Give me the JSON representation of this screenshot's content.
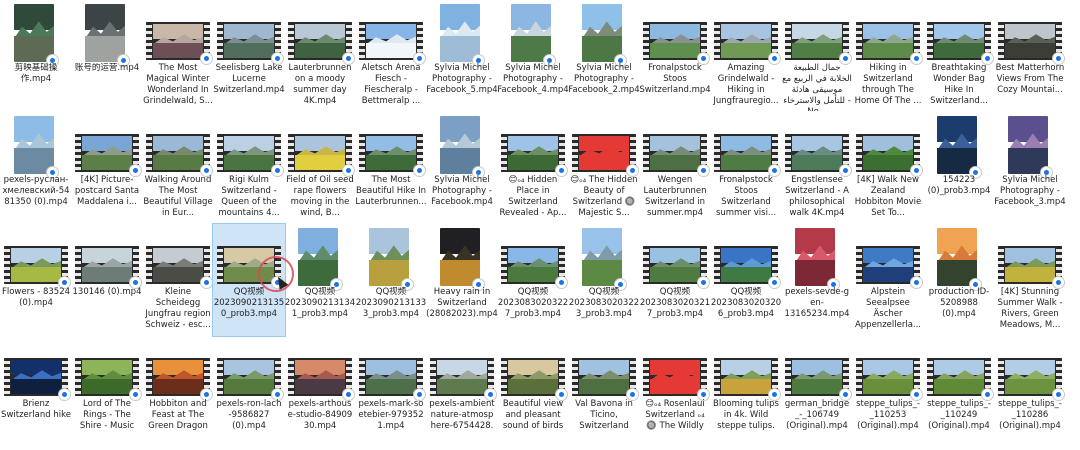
{
  "rows": [
    {
      "items": [
        {
          "label": "剪映基础操作.mp4",
          "kind": "port",
          "c1": "#2f4a3a",
          "c2": "#4c7a58",
          "c3": "#5d6b55"
        },
        {
          "label": "账号的运营.mp4",
          "kind": "port",
          "c1": "#3c4447",
          "c2": "#6b7170",
          "c3": "#9ea39f"
        },
        {
          "label": "The Most Magical Winter Wonderland In Grindelwald, S...",
          "kind": "vid",
          "c1": "#c9b8a8",
          "c2": "#b7a7a3",
          "c3": "#6d4f55"
        },
        {
          "label": "Seelisberg Lake Lucerne Switzerland.mp4",
          "kind": "vid",
          "c1": "#9fb7cf",
          "c2": "#7c8d93",
          "c3": "#4f6f5a"
        },
        {
          "label": "Lauterbrunnen on a moody summer day 4K.mp4",
          "kind": "vid",
          "c1": "#b8c8d4",
          "c2": "#6c8a6e",
          "c3": "#3f6340"
        },
        {
          "label": "Aletsch Arena Fiesch - Fiescheralp - Bettmeralp ...",
          "kind": "vid",
          "c1": "#87b5e8",
          "c2": "#dfe9f2",
          "c3": "#f3f6f8"
        },
        {
          "label": "Sylvia Michel Photography - Facebook_5.mp4",
          "kind": "port",
          "c1": "#7fb2e0",
          "c2": "#dce8f2",
          "c3": "#9fbcd6"
        },
        {
          "label": "Sylvia Michel Photography - Facebook_4.mp4",
          "kind": "port",
          "c1": "#8bb7e2",
          "c2": "#c8d5dd",
          "c3": "#4e7a4a"
        },
        {
          "label": "Sylvia Michel Photography - Facebook_2.mp4",
          "kind": "port",
          "c1": "#8ec0ea",
          "c2": "#7e8d7a",
          "c3": "#4d7845"
        },
        {
          "label": "Fronalpstock Stoos Switzerland.mp4",
          "kind": "vid",
          "c1": "#8db8e0",
          "c2": "#8a9190",
          "c3": "#5f8f4f"
        },
        {
          "label": "Amazing Grindelwald - Hiking in Jungfrauregio...",
          "kind": "vid",
          "c1": "#a8c4e2",
          "c2": "#9ea7ad",
          "c3": "#6f9a55"
        },
        {
          "label": "جمال الطبيعة الخلابة في الربيع مع موسيقى هادئة للتأمل والاسترخاء - No...",
          "kind": "vid",
          "c1": "#c6d7e6",
          "c2": "#7fa07a",
          "c3": "#4f7f45"
        },
        {
          "label": "Hiking in Switzerland through The Home Of The ...",
          "kind": "vid",
          "c1": "#9cc0e6",
          "c2": "#8fa68f",
          "c3": "#5e8a4a"
        },
        {
          "label": "Breathtaking Wonder Bag Hike In Switzerland...",
          "kind": "vid",
          "c1": "#a3c7ea",
          "c2": "#6e8c74",
          "c3": "#3f6a3b"
        },
        {
          "label": "Best Matterhorn Views From The Cozy Mountai...",
          "kind": "vid",
          "c1": "#bfc6cb",
          "c2": "#5c5f57",
          "c3": "#3a3e35"
        }
      ]
    },
    {
      "items": [
        {
          "label": "pexels-руслан-хмелевский-5481350 (0).mp4",
          "kind": "port",
          "c1": "#8dbde6",
          "c2": "#a9c7d8",
          "c3": "#6d8aa3"
        },
        {
          "label": "[4K] Picture-postcard Santa Maddalena i...",
          "kind": "vid",
          "c1": "#7aa6d6",
          "c2": "#8d9c8c",
          "c3": "#5b7f47"
        },
        {
          "label": "Walking Around The Most Beautiful Village in Eur...",
          "kind": "vid",
          "c1": "#9bb9d6",
          "c2": "#7a8a6e",
          "c3": "#587a44"
        },
        {
          "label": "Rigi Kulm Switzerland - Queen of the mountains 4...",
          "kind": "vid",
          "c1": "#bcd0e3",
          "c2": "#7c9680",
          "c3": "#4a7440"
        },
        {
          "label": "Field of Oil seed rape flowers moving in the wind, B...",
          "kind": "vid",
          "c1": "#a9c4dc",
          "c2": "#c9b64a",
          "c3": "#e2cf3d"
        },
        {
          "label": "The Most Beautiful Hike In Lauterbrunnen...",
          "kind": "vid",
          "c1": "#93bde6",
          "c2": "#6f8f6c",
          "c3": "#3e6b3a"
        },
        {
          "label": "Sylvia Michel Photography - Facebook.mp4",
          "kind": "port",
          "c1": "#7c9fc6",
          "c2": "#b6c9d6",
          "c3": "#5f7f9e"
        },
        {
          "label": "😊ₒ₄ Hidden Place in Switzerland Revealed - Ap...",
          "kind": "vid",
          "c1": "#9ec3e6",
          "c2": "#6e8f62",
          "c3": "#3d6a34"
        },
        {
          "label": "😊ₒ₄ The Hidden Beauty of Switzerland 🔘 Majestic S...",
          "kind": "vid",
          "c1": "#e53935",
          "c2": "#e53935",
          "c3": "#e53935"
        },
        {
          "label": "Wengen Lauterbrunnen Switzerland in summer.mp4",
          "kind": "vid",
          "c1": "#a4c2dc",
          "c2": "#778c79",
          "c3": "#4d6f44"
        },
        {
          "label": "Fronalpstock Stoos Switzerland summer visi...",
          "kind": "vid",
          "c1": "#8dbbe4",
          "c2": "#7d8f80",
          "c3": "#4f7c44"
        },
        {
          "label": "Engstlensee Switzerland - A philosophical walk 4K.mp4",
          "kind": "vid",
          "c1": "#a8c6e3",
          "c2": "#6b8c84",
          "c3": "#4d7a58"
        },
        {
          "label": "[4K] Walk New Zealand Hobbiton Movie Set To...",
          "kind": "vid",
          "c1": "#9fbfdc",
          "c2": "#4f8a3e",
          "c3": "#3b6f2f"
        },
        {
          "label": "154223 (0)_prob3.mp4",
          "kind": "port",
          "c1": "#1d3c6e",
          "c2": "#3b5f99",
          "c3": "#172a44"
        },
        {
          "label": "Sylvia Michel Photography - Facebook_3.mp4",
          "kind": "port",
          "c1": "#5c4f8f",
          "c2": "#9b7fb3",
          "c3": "#2f3a5a"
        }
      ]
    },
    {
      "items": [
        {
          "label": "Flowers - 83524 (0).mp4",
          "kind": "vid",
          "c1": "#b8d0e4",
          "c2": "#7a9a5c",
          "c3": "#a7b844"
        },
        {
          "label": "130146 (0).mp4",
          "kind": "vid",
          "c1": "#c8d4dc",
          "c2": "#9aa6a6",
          "c3": "#6e7c78"
        },
        {
          "label": "Kleine Scheidegg Jungfrau region Schweiz - esc...",
          "kind": "vid",
          "c1": "#c4ccd2",
          "c2": "#7b7d78",
          "c3": "#4a4d46"
        },
        {
          "label": "QQ视频 20230902131350_prob3.mp4",
          "kind": "vid",
          "c1": "#d8c9a6",
          "c2": "#9eaa88",
          "c3": "#6f8c4a",
          "selected": true
        },
        {
          "label": "QQ视频 20230902131341_prob3.mp4",
          "kind": "port",
          "c1": "#7fb0e0",
          "c2": "#5f8c6a",
          "c3": "#3d6b3c"
        },
        {
          "label": "QQ视频 20230902131333_prob3.mp4",
          "kind": "port",
          "c1": "#a9c4dc",
          "c2": "#6f8f5a",
          "c3": "#b9a03f"
        },
        {
          "label": "Heavy rain in Switzerland (28082023).mp4",
          "kind": "port",
          "c1": "#1f1f24",
          "c2": "#3a3324",
          "c3": "#c08b2e"
        },
        {
          "label": "QQ视频 20230830203227_prob3.mp4",
          "kind": "vid",
          "c1": "#8ab8e6",
          "c2": "#6a8f6e",
          "c3": "#4a7a3e"
        },
        {
          "label": "QQ视频 20230830203223_prob3.mp4",
          "kind": "port",
          "c1": "#98c2ea",
          "c2": "#7f9ba8",
          "c3": "#5c8a44"
        },
        {
          "label": "QQ视频 20230830203217_prob3.mp4",
          "kind": "vid",
          "c1": "#9ac0e2",
          "c2": "#6c8e6c",
          "c3": "#4f7a40"
        },
        {
          "label": "QQ视频 20230830203206_prob3.mp4",
          "kind": "vid",
          "c1": "#3a74c4",
          "c2": "#5f9ad8",
          "c3": "#3d7a44"
        },
        {
          "label": "pexels-sevde-g en-13165234.mp4",
          "kind": "port",
          "c1": "#b43a4a",
          "c2": "#d85a6a",
          "c3": "#7c2836"
        },
        {
          "label": "Alpstein Seealpsee Äscher Appenzellerla...",
          "kind": "vid",
          "c1": "#3f7ac4",
          "c2": "#6fa6e0",
          "c3": "#1e3f7a"
        },
        {
          "label": "production ID-5208988 (0).mp4",
          "kind": "port",
          "c1": "#f0a352",
          "c2": "#d77a3a",
          "c3": "#34432e"
        },
        {
          "label": "[4K] Stunning Summer Walk - Rivers, Green Meadows, M...",
          "kind": "vid",
          "c1": "#9fc0de",
          "c2": "#7d9a5a",
          "c3": "#c0b23c"
        }
      ]
    },
    {
      "items": [
        {
          "label": "Brienz Switzerland hike",
          "kind": "vid",
          "c1": "#14306b",
          "c2": "#3b6fc0",
          "c3": "#0e1f3f"
        },
        {
          "label": "Lord of The Rings - The Shire - Music",
          "kind": "vid",
          "c1": "#8eb45a",
          "c2": "#5f8f3c",
          "c3": "#3d6a2a"
        },
        {
          "label": "Hobbiton and Feast at The Green Dragon",
          "kind": "vid",
          "c1": "#e8913a",
          "c2": "#c0562a",
          "c3": "#6b2e1a"
        },
        {
          "label": "pexels-ron-lach -9586827 (0).mp4",
          "kind": "vid",
          "c1": "#a9c4de",
          "c2": "#7a9a6a",
          "c3": "#557a3e"
        },
        {
          "label": "pexels-arthous e-studio-84909 30.mp4",
          "kind": "vid",
          "c1": "#d68a6a",
          "c2": "#a65a50",
          "c3": "#4a3a44"
        },
        {
          "label": "pexels-mark-so etebier-979352 1.mp4",
          "kind": "vid",
          "c1": "#9ec0e0",
          "c2": "#7a8f8a",
          "c3": "#4d6f4a"
        },
        {
          "label": "pexels-ambient nature-atmosp here-6754428.",
          "kind": "vid",
          "c1": "#c7d7e6",
          "c2": "#9fa89a",
          "c3": "#5f7a4e"
        },
        {
          "label": "Beautiful view and pleasant sound of birds",
          "kind": "vid",
          "c1": "#d8c8a0",
          "c2": "#8f9a6a",
          "c3": "#5a6f3a"
        },
        {
          "label": "Val Bavona in Ticino, Switzerland",
          "kind": "vid",
          "c1": "#a0c2e0",
          "c2": "#7c8e6e",
          "c3": "#4e6f42"
        },
        {
          "label": "😊ₒ₄ Rosenlaui Switzerland ₒ₄ 🔘 The Wildly",
          "kind": "vid",
          "c1": "#e53935",
          "c2": "#e53935",
          "c3": "#e53935"
        },
        {
          "label": "Blooming tulips in 4k. Wild steppe tulips.",
          "kind": "vid",
          "c1": "#b8d0e6",
          "c2": "#7fa05a",
          "c3": "#c9a23c"
        },
        {
          "label": "german_bridge _-_106749 (Original).mp4",
          "kind": "vid",
          "c1": "#9dc0e2",
          "c2": "#7c9a72",
          "c3": "#4e7a40"
        },
        {
          "label": "steppe_tulips_-_110253 (Original).mp4",
          "kind": "vid",
          "c1": "#a9c8e6",
          "c2": "#8aa860",
          "c3": "#6a8f3a"
        },
        {
          "label": "steppe_tulips_-_110249 (Original).mp4",
          "kind": "vid",
          "c1": "#aecbe6",
          "c2": "#86a45e",
          "c3": "#5f8a38"
        },
        {
          "label": "steppe_tulips_-_110286 (Original).mp4",
          "kind": "vid",
          "c1": "#b2cde6",
          "c2": "#8fae62",
          "c3": "#6b9340"
        }
      ]
    }
  ]
}
